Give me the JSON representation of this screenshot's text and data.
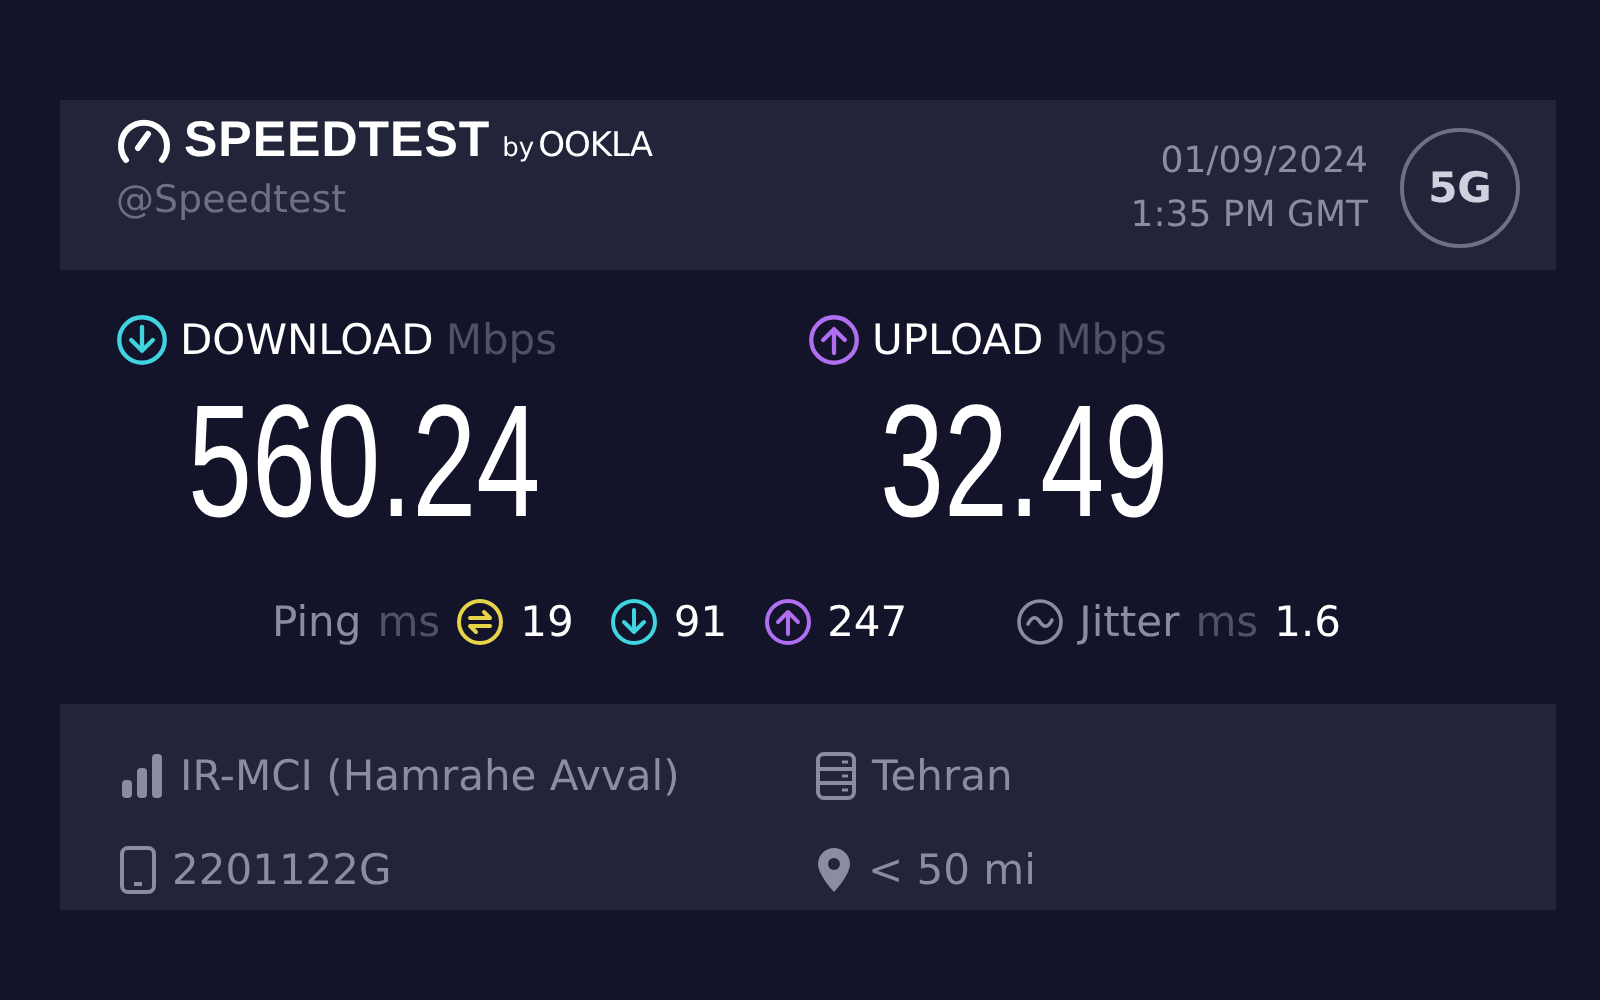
{
  "header": {
    "brand": "SPEEDTEST",
    "by": "by",
    "partner": "OOKLA",
    "handle": "@Speedtest",
    "date": "01/09/2024",
    "time": "1:35 PM GMT",
    "network_badge": "5G"
  },
  "results": [
    {
      "kind": "download",
      "label": "DOWNLOAD",
      "unit": "Mbps",
      "value": "560.24"
    },
    {
      "kind": "upload",
      "label": "UPLOAD",
      "unit": "Mbps",
      "value": "32.49"
    }
  ],
  "ping": {
    "label": "Ping",
    "unit": "ms",
    "values": [
      {
        "kind": "idle",
        "value": "19"
      },
      {
        "kind": "download",
        "value": "91"
      },
      {
        "kind": "upload",
        "value": "247"
      }
    ]
  },
  "jitter": {
    "label": "Jitter",
    "unit": "ms",
    "value": "1.6"
  },
  "details": [
    {
      "kind": "provider",
      "text": "IR-MCI (Hamrahe Avval)"
    },
    {
      "kind": "server",
      "text": "Tehran"
    },
    {
      "kind": "device",
      "text": "2201122G"
    },
    {
      "kind": "distance",
      "text": "< 50 mi"
    }
  ]
}
